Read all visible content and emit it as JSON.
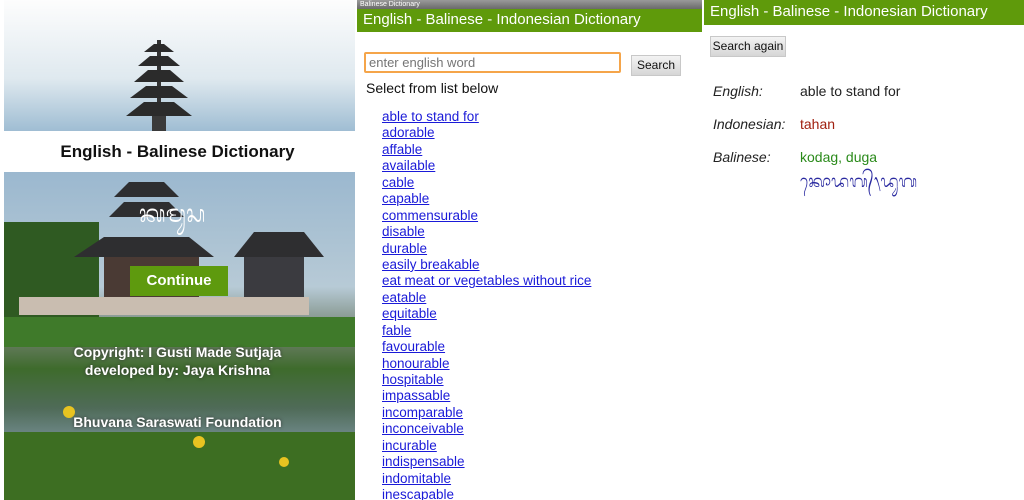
{
  "splash": {
    "title": "English - Balinese Dictionary",
    "continue_label": "Continue",
    "copyright": "Copyright: I Gusti Made Sutjaja",
    "developer": "developed by: Jaya Krishna",
    "foundation": "Bhuvana Saraswati Foundation",
    "logo_script": "ᬓᬫᬸᬲ᭄"
  },
  "search": {
    "status_title": "Balinese Dictionary",
    "app_title": "English - Balinese - Indonesian Dictionary",
    "placeholder": "enter english word",
    "search_label": "Search",
    "list_heading": "Select from list below",
    "words": [
      "able to stand for ",
      "adorable",
      "affable",
      "available",
      "cable",
      "capable",
      "commensurable",
      "disable",
      "durable ",
      "easily breakable",
      "eat meat or vegetables without rice",
      "eatable",
      "equitable",
      "fable",
      "favourable",
      "honourable",
      "hospitable",
      "impassable",
      "incomparable",
      "inconceivable",
      "incurable",
      "indispensable ",
      "indomitable",
      "inescapable"
    ]
  },
  "result": {
    "app_title": "English - Balinese - Indonesian Dictionary",
    "search_again_label": "Search again",
    "english_label": "English:",
    "english_value": "able to stand for",
    "indonesian_label": "Indonesian:",
    "indonesian_value": "tahan",
    "balinese_label": "Balinese:",
    "balinese_value": "kodag, duga",
    "balinese_script": "ᬓᭀᬤᬕ᭄᭞ᬤᬸᬕ"
  },
  "colors": {
    "green": "#5f9a0b",
    "link": "#1a1ad8",
    "indonesian": "#a02010",
    "balinese": "#2a8a1a"
  }
}
